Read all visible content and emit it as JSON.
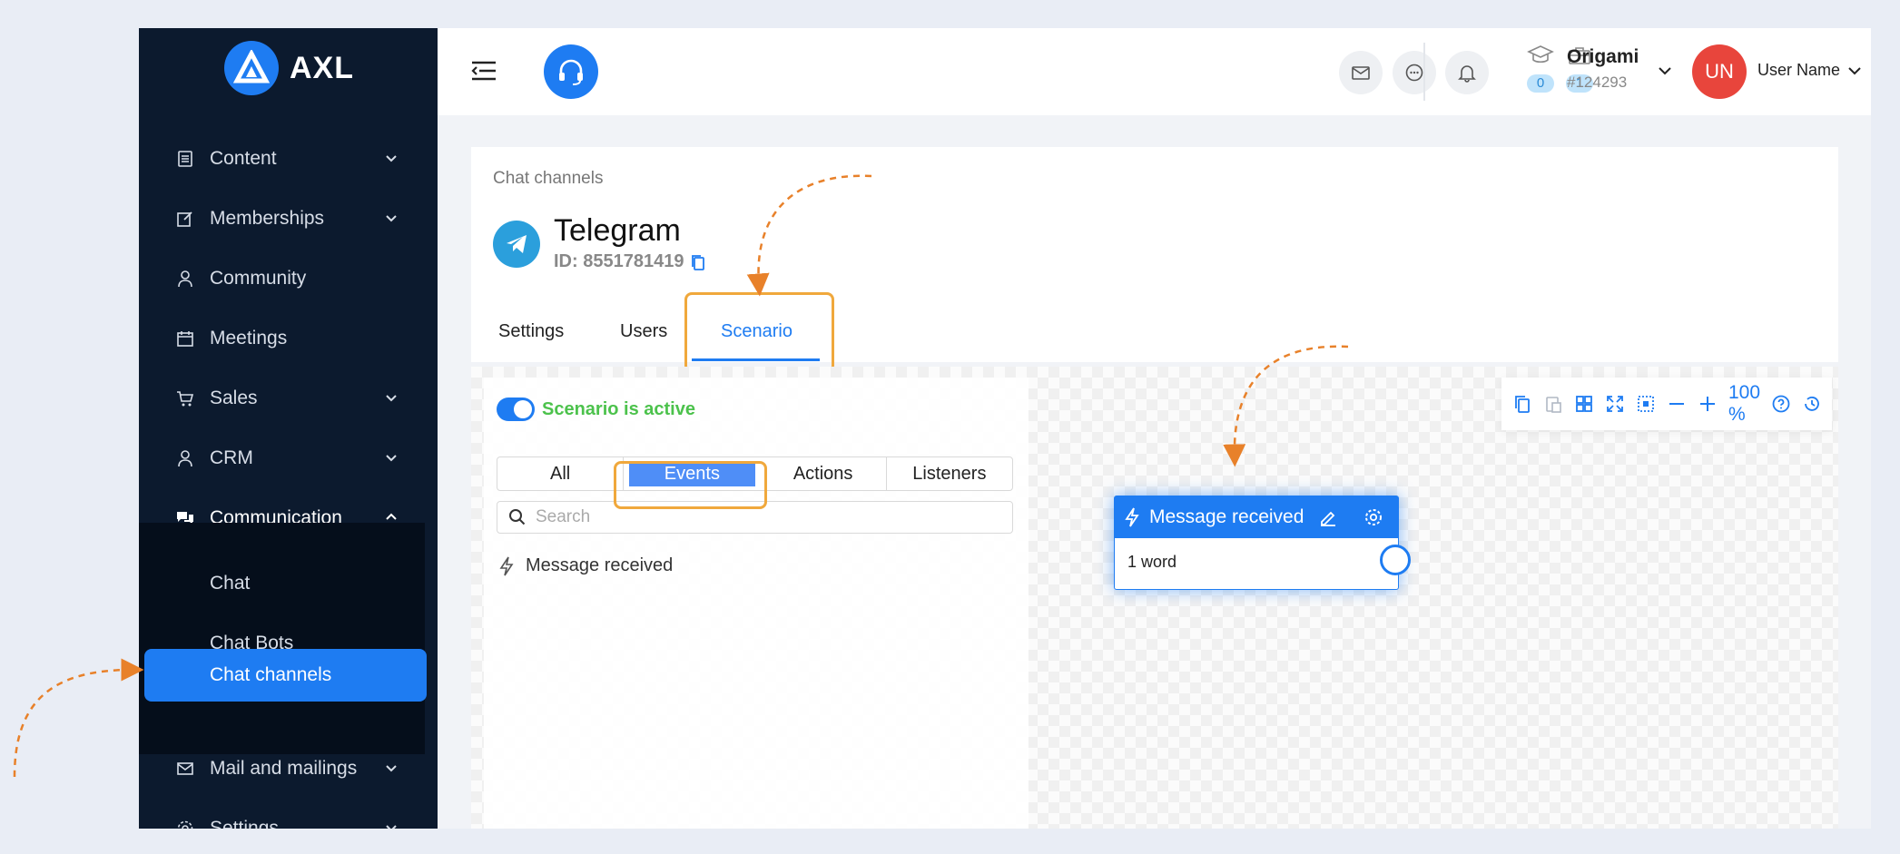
{
  "brand": {
    "name": "AXL",
    "accent": "#1e7cf2",
    "sidebar_bg": "#0c1a2e"
  },
  "sidebar": {
    "items": [
      {
        "label": "Content",
        "icon": "document-icon",
        "expandable": true
      },
      {
        "label": "Memberships",
        "icon": "edit-icon",
        "expandable": true
      },
      {
        "label": "Community",
        "icon": "user-icon",
        "expandable": false
      },
      {
        "label": "Meetings",
        "icon": "calendar-icon",
        "expandable": false
      },
      {
        "label": "Sales",
        "icon": "cart-icon",
        "expandable": true
      },
      {
        "label": "CRM",
        "icon": "user-icon",
        "expandable": true
      },
      {
        "label": "Communication",
        "icon": "chat-bubbles-icon",
        "expandable": true,
        "open": true
      },
      {
        "label": "Mail and mailings",
        "icon": "mail-icon",
        "expandable": true
      },
      {
        "label": "Settings",
        "icon": "gear-icon",
        "expandable": true
      }
    ],
    "sub_items": [
      {
        "label": "Chat"
      },
      {
        "label": "Chat Bots"
      },
      {
        "label": "Chat channels",
        "active": true
      }
    ]
  },
  "header": {
    "counters": [
      {
        "icon": "graduation-cap-icon",
        "value": "0"
      },
      {
        "icon": "briefcase-icon",
        "value": "1"
      }
    ],
    "org": {
      "name": "Origami",
      "id": "#124293"
    },
    "user": {
      "initials": "UN",
      "name": "User Name"
    }
  },
  "page": {
    "breadcrumb": "Chat channels",
    "channel_name": "Telegram",
    "channel_id": "ID: 8551781419",
    "tabs": [
      {
        "label": "Settings"
      },
      {
        "label": "Users"
      },
      {
        "label": "Scenario",
        "active": true
      }
    ]
  },
  "scenario": {
    "status_label": "Scenario is active",
    "active": true,
    "filters": [
      {
        "label": "All"
      },
      {
        "label": "Events",
        "selected": true
      },
      {
        "label": "Actions"
      },
      {
        "label": "Listeners"
      }
    ],
    "search_placeholder": "Search",
    "list": [
      {
        "label": "Message received",
        "icon": "lightning-icon"
      }
    ],
    "zoom": "100 %",
    "node": {
      "title": "Message received",
      "body": "1 word"
    }
  }
}
